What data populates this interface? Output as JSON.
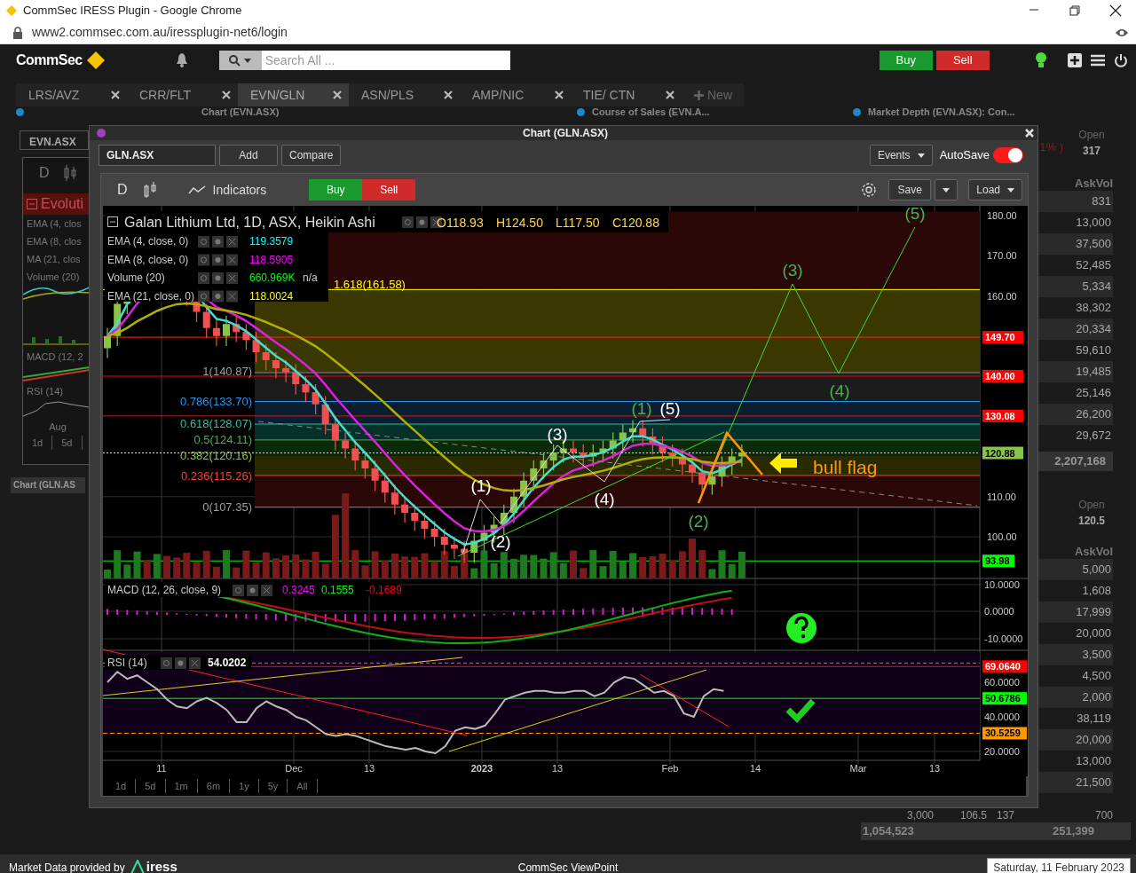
{
  "browser": {
    "title": "CommSec IRESS Plugin - Google Chrome",
    "url": "www2.commsec.com.au/iressplugin-net6/login"
  },
  "header": {
    "logo": "CommSec",
    "search_placeholder": "Search All ...",
    "actions": [
      {
        "label": "Buy",
        "kind": "buy"
      },
      {
        "label": "Sell",
        "kind": "sell"
      }
    ]
  },
  "tabs": [
    {
      "label": "LRS/AVZ",
      "selected": false
    },
    {
      "label": "CRR/FLT",
      "selected": false
    },
    {
      "label": "EVN/GLN",
      "selected": true
    },
    {
      "label": "ASN/PLS",
      "selected": false
    },
    {
      "label": "AMP/NIC",
      "selected": false
    },
    {
      "label": "TIE/ CTN",
      "selected": false
    }
  ],
  "new_tab": "New",
  "panel_headers": [
    "Chart (EVN.ASX)",
    "Course of Sales (EVN.A...",
    "Market Depth (EVN.ASX): Con..."
  ],
  "left_panel": {
    "symbol": "EVN.ASX",
    "interval": "D",
    "legend_title": "Evoluti",
    "legend": [
      "EMA (4, clos",
      "EMA (8, clos",
      "MA (21, clos",
      "Volume (20)"
    ],
    "macd": "MACD (12, 2",
    "rsi": "RSI (14)",
    "axis_label": "Aug",
    "periods": [
      "1d",
      "5d"
    ],
    "window_tab": "Chart (GLN.AS"
  },
  "market_depth": {
    "change": "1% )",
    "open_label": "Open",
    "open_value": "317",
    "askvol_label": "AskVol",
    "ask_volumes": [
      "831",
      "13,000",
      "37,500",
      "52,485",
      "5,334",
      "38,302",
      "20,334",
      "59,610",
      "19,485",
      "25,146",
      "26,200",
      "29,672"
    ],
    "total": "2,207,168",
    "open_label_2": "Open",
    "open_value_2": "120.5",
    "askvol_label_2": "AskVol",
    "ask_volumes_2": [
      "5,000",
      "1,608",
      "17,999",
      "20,000",
      "3,500",
      "4,500",
      "2,000",
      "38,119",
      "20,000",
      "13,000",
      "21,500"
    ],
    "summary": [
      "3,000",
      "106.5",
      "137",
      "700"
    ],
    "totals": [
      "1,054,523",
      "251,399"
    ]
  },
  "chart_window": {
    "title": "Chart (GLN.ASX)",
    "symbol": "GLN.ASX",
    "add": "Add",
    "compare": "Compare",
    "events": "Events",
    "autosave": {
      "label": "AutoSave",
      "on": true
    },
    "interval": "D",
    "indicators": "Indicators",
    "trade": [
      {
        "label": "Buy",
        "kind": "buy"
      },
      {
        "label": "Sell",
        "kind": "sell"
      }
    ],
    "save": "Save",
    "load": "Load",
    "legend_title": "Galan Lithium Ltd, 1D, ASX, Heikin Ashi",
    "ohlc": [
      "O118.93",
      "H124.50",
      "L117.50",
      "C120.88"
    ],
    "studies": [
      {
        "name": "EMA (4, close, 0)",
        "value": "119.3579",
        "color": "#00ffff"
      },
      {
        "name": "EMA (8, close, 0)",
        "value": "118.5905",
        "color": "#ff00ff"
      },
      {
        "name": "Volume (20)",
        "value": "660.969K",
        "extra": "n/a",
        "color": "#00ff00"
      },
      {
        "name": "EMA (21, close, 0)",
        "value": "118.0024",
        "color": "#ffff00"
      }
    ],
    "fib_levels": [
      {
        "label": "1.618(161.58)",
        "color": "#ffff00"
      },
      {
        "label": "1(140.87)",
        "color": "#9e9e9e"
      },
      {
        "label": "0.786(133.70)",
        "color": "#2196f3"
      },
      {
        "label": "0.618(128.07)",
        "color": "#26c6a0"
      },
      {
        "label": "0.5(124.11)",
        "color": "#4caf50"
      },
      {
        "label": "0.382(120.16)",
        "color": "#8bc34a"
      },
      {
        "label": "0.236(115.26)",
        "color": "#f44336"
      },
      {
        "label": "0(107.35)",
        "color": "#9e9e9e"
      }
    ],
    "price_axis": [
      "180.00",
      "170.00",
      "160.00",
      "110.00",
      "100.00"
    ],
    "price_badges": [
      {
        "value": "149.70",
        "color": "#ff0000"
      },
      {
        "value": "140.00",
        "color": "#ff0000"
      },
      {
        "value": "130.08",
        "color": "#ff0000"
      },
      {
        "value": "120.88",
        "color": "#8bc34a"
      },
      {
        "value": "93.98",
        "color": "#00ff00"
      }
    ],
    "waves": [
      {
        "label": "(1)",
        "color": "#ffffff"
      },
      {
        "label": "(2)",
        "color": "#ffffff"
      },
      {
        "label": "(3)",
        "color": "#ffffff"
      },
      {
        "label": "(4)",
        "color": "#ffffff"
      },
      {
        "label": "(5)",
        "color": "#ffffff"
      },
      {
        "label": "(1)",
        "color": "#4caf50"
      },
      {
        "label": "(2)",
        "color": "#4caf50"
      },
      {
        "label": "(3)",
        "color": "#4caf50"
      },
      {
        "label": "(4)",
        "color": "#4caf50"
      },
      {
        "label": "(5)",
        "color": "#4caf50"
      }
    ],
    "annotation": "bull flag",
    "macd": {
      "name": "MACD (12, 26, close, 9)",
      "values": [
        {
          "value": "0.3245",
          "color": "#ff00ff"
        },
        {
          "value": "0.1555",
          "color": "#00ff00"
        },
        {
          "value": "-0.1689",
          "color": "#ff0000"
        }
      ],
      "axis": [
        "10.0000",
        "0.0000",
        "-10.0000"
      ]
    },
    "rsi": {
      "name": "RSI (14)",
      "value": "54.0202",
      "axis": [
        "60.0000",
        "40.0000",
        "20.0000"
      ],
      "badges": [
        {
          "value": "69.0640",
          "color": "#ff0000"
        },
        {
          "value": "50.6786",
          "color": "#00ff00"
        },
        {
          "value": "30.5259",
          "color": "#ff9800"
        }
      ]
    },
    "time_axis": [
      {
        "label": "11",
        "kind": "day"
      },
      {
        "label": "Dec",
        "kind": "month"
      },
      {
        "label": "13",
        "kind": "day"
      },
      {
        "label": "2023",
        "kind": "year"
      },
      {
        "label": "13",
        "kind": "day"
      },
      {
        "label": "Feb",
        "kind": "month"
      },
      {
        "label": "14",
        "kind": "day"
      },
      {
        "label": "Mar",
        "kind": "month"
      },
      {
        "label": "13",
        "kind": "day"
      }
    ],
    "periods": [
      "1d",
      "5d",
      "1m",
      "6m",
      "1y",
      "5y",
      "All"
    ]
  },
  "footer": {
    "provider": "Market Data provided by",
    "brand": "iress",
    "center": "CommSec ViewPoint",
    "date": "Saturday, 11 February 2023"
  }
}
